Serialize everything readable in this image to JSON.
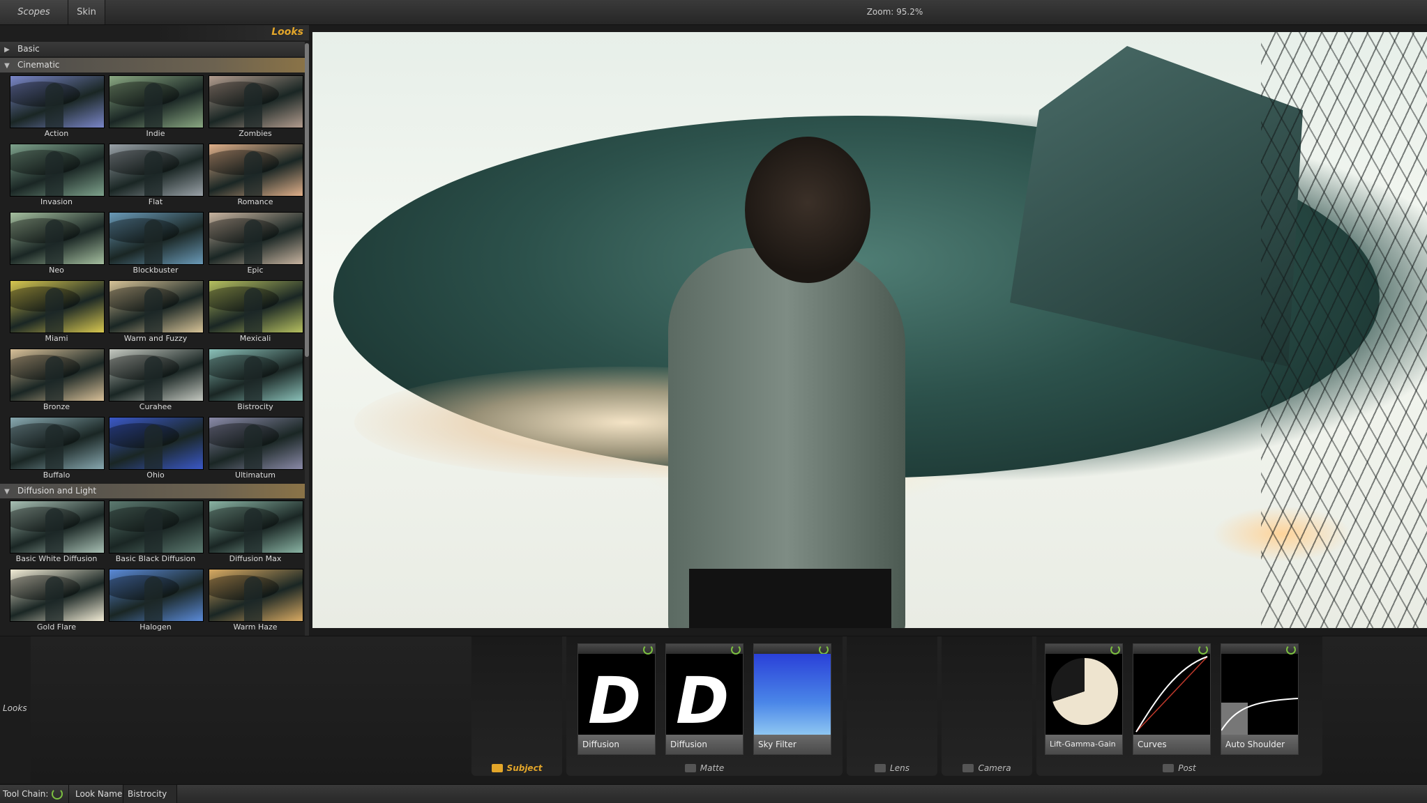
{
  "topbar": {
    "scopes_label": "Scopes",
    "skin_label": "Skin",
    "zoom_text": "Zoom:  95.2%"
  },
  "looks_panel": {
    "title": "Looks",
    "categories": [
      {
        "label": "Basic",
        "expanded": false
      },
      {
        "label": "Cinematic",
        "expanded": true
      },
      {
        "label": "Diffusion and Light",
        "expanded": true
      }
    ],
    "cinematic_looks": [
      {
        "name": "Action",
        "tint": "#7a86c8"
      },
      {
        "name": "Indie",
        "tint": "#8aa882"
      },
      {
        "name": "Zombies",
        "tint": "#b29c8e"
      },
      {
        "name": "Invasion",
        "tint": "#7ea28c"
      },
      {
        "name": "Flat",
        "tint": "#9aa2a8"
      },
      {
        "name": "Romance",
        "tint": "#e0b08a"
      },
      {
        "name": "Neo",
        "tint": "#a6c0a0"
      },
      {
        "name": "Blockbuster",
        "tint": "#6a9ab8"
      },
      {
        "name": "Epic",
        "tint": "#c8b4a0"
      },
      {
        "name": "Miami",
        "tint": "#d8c850"
      },
      {
        "name": "Warm and Fuzzy",
        "tint": "#d8c498"
      },
      {
        "name": "Mexicali",
        "tint": "#b6c060"
      },
      {
        "name": "Bronze",
        "tint": "#d8c098"
      },
      {
        "name": "Curahee",
        "tint": "#c4c8c0"
      },
      {
        "name": "Bistrocity",
        "tint": "#8ac0b8"
      },
      {
        "name": "Buffalo",
        "tint": "#88a8b0"
      },
      {
        "name": "Ohio",
        "tint": "#3a58c8"
      },
      {
        "name": "Ultimatum",
        "tint": "#8a8aa8"
      }
    ],
    "diffusion_looks": [
      {
        "name": "Basic White Diffusion",
        "tint": "#a8c0b4"
      },
      {
        "name": "Basic Black Diffusion",
        "tint": "#5c7a70"
      },
      {
        "name": "Diffusion Max",
        "tint": "#8ab4a4"
      },
      {
        "name": "Gold Flare",
        "tint": "#f2ecd6"
      },
      {
        "name": "Halogen",
        "tint": "#5a8ad8"
      },
      {
        "name": "Warm Haze",
        "tint": "#d8aa62"
      }
    ]
  },
  "toolchain": {
    "left_label": "Looks",
    "sections": {
      "subject": "Subject",
      "matte": "Matte",
      "lens": "Lens",
      "camera": "Camera",
      "post": "Post"
    },
    "tools": [
      {
        "label": "Diffusion",
        "preview": "d-glyph",
        "glyph": "D"
      },
      {
        "label": "Diffusion",
        "preview": "d-glyph",
        "glyph": "D"
      },
      {
        "label": "Sky Filter",
        "preview": "sky-gradient"
      },
      {
        "label": "Lift-Gamma-Gain",
        "preview": "lgg-circle"
      },
      {
        "label": "Curves",
        "preview": "curves"
      },
      {
        "label": "Auto Shoulder",
        "preview": "auto-shoulder"
      }
    ]
  },
  "statusbar": {
    "tool_chain_label": "Tool Chain:",
    "look_name_label": "Look Name:",
    "look_name_value": "Bistrocity"
  },
  "colors": {
    "accent_gold": "#e3a62a",
    "power_green": "#7cc040",
    "panel_bg": "#1e1e1e"
  }
}
